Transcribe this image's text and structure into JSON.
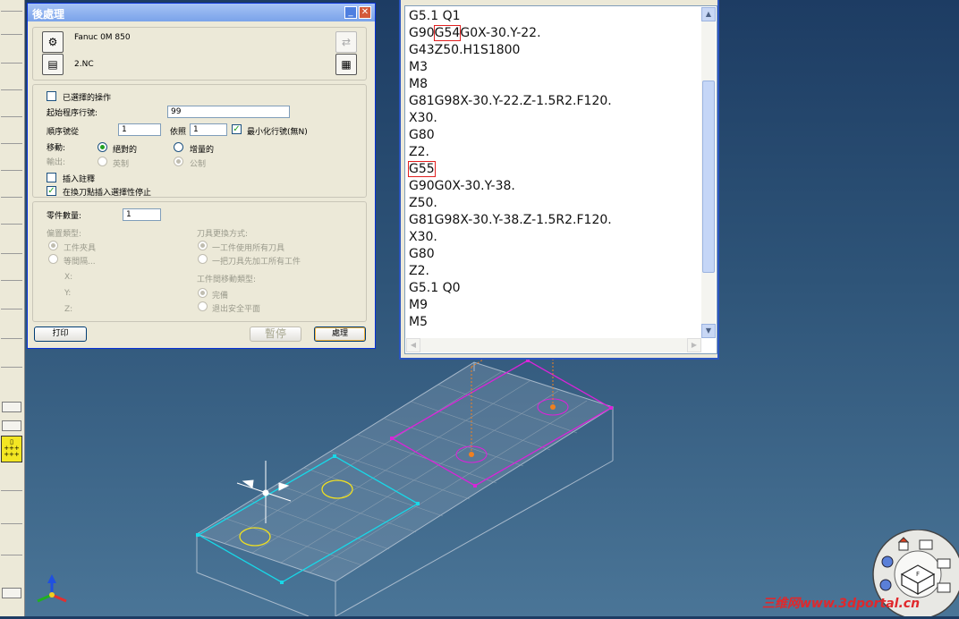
{
  "dialog": {
    "title": "後處理",
    "minimize_symbol": "_",
    "close_symbol": "✕",
    "machine_name": "Fanuc 0M 850",
    "output_file": "2.NC",
    "selected_ops_label": "已選擇的操作",
    "start_line_label": "起始程序行號:",
    "start_line_value": "99",
    "sequence_label": "順序號從",
    "sequence_value": "1",
    "increment_label": "依照",
    "increment_value": "1",
    "minimize_lines_label": "最小化行號(無N)",
    "move_label": "移動:",
    "absolute_label": "絕對的",
    "incremental_label": "增量的",
    "output_label": "輸出:",
    "inch_label": "英制",
    "metric_label": "公制",
    "insert_comment_label": "插入註釋",
    "insert_optional_stop_label": "在換刀點插入選擇性停止",
    "part_count_label": "零件數量:",
    "part_count_value": "1",
    "offset_type_label": "偏置類型:",
    "fixture_label": "工件夾具",
    "equal_spacing_label": "等間隔...",
    "x_label": "X:",
    "y_label": "Y:",
    "z_label": "Z:",
    "tool_change_label": "刀具更換方式:",
    "tool_change_opt1": "一工件使用所有刀具",
    "tool_change_opt2": "一把刀具先加工所有工件",
    "inter_part_move_label": "工件間移動類型:",
    "inter_part_opt1": "完備",
    "inter_part_opt2": "退出安全平面",
    "print_button": "打印",
    "pause_button": "暫停",
    "process_button": "處理"
  },
  "code_window": {
    "lines": [
      "G5.1 Q1",
      "G90G54G0X-30.Y-22.",
      "G43Z50.H1S1800",
      "M3",
      "M8",
      "G81G98X-30.Y-22.Z-1.5R2.F120.",
      "X30.",
      "G80",
      "Z2.",
      "G55",
      "G90G0X-30.Y-38.",
      "Z50.",
      "G81G98X-30.Y-38.Z-1.5R2.F120.",
      "X30.",
      "G80",
      "Z2.",
      "G5.1 Q0",
      "M9",
      "M5"
    ],
    "line2_pre": "G90",
    "line2_hl": "G54",
    "line2_post": "G0X-30.Y-22.",
    "scroll_up": "▲",
    "scroll_down": "▼",
    "scroll_left": "◀",
    "scroll_right": "▶"
  },
  "watermark": "三维网www.3dportal.cn",
  "colors": {
    "part1_outline": "#18d8e8",
    "part2_outline": "#d824d8",
    "hole_yellow": "#f0e020",
    "hole_orange": "#f08020",
    "highlight_red": "#e02020"
  },
  "icons": [
    "machine-icon",
    "file-icon",
    "output-file-icon",
    "report-icon",
    "compass-view-icon",
    "axis-triad-icon"
  ]
}
